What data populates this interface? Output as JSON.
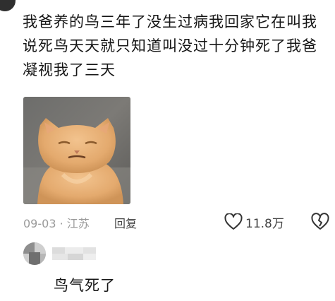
{
  "comment": {
    "lines": [
      "我爸养的鸟三年了没生过病我回家它在叫我",
      "说死鸟天天就只知道叫没过十分钟死了我爸",
      "凝视我了三天"
    ],
    "image_icon": "cat-photo",
    "date": "09-03",
    "separator": "·",
    "location": "江苏",
    "reply_label": "回复",
    "like_count": "11.8万",
    "like_icon": "heart-outline-icon",
    "dislike_icon": "broken-heart-icon"
  },
  "reply": {
    "text": "鸟气死了"
  }
}
